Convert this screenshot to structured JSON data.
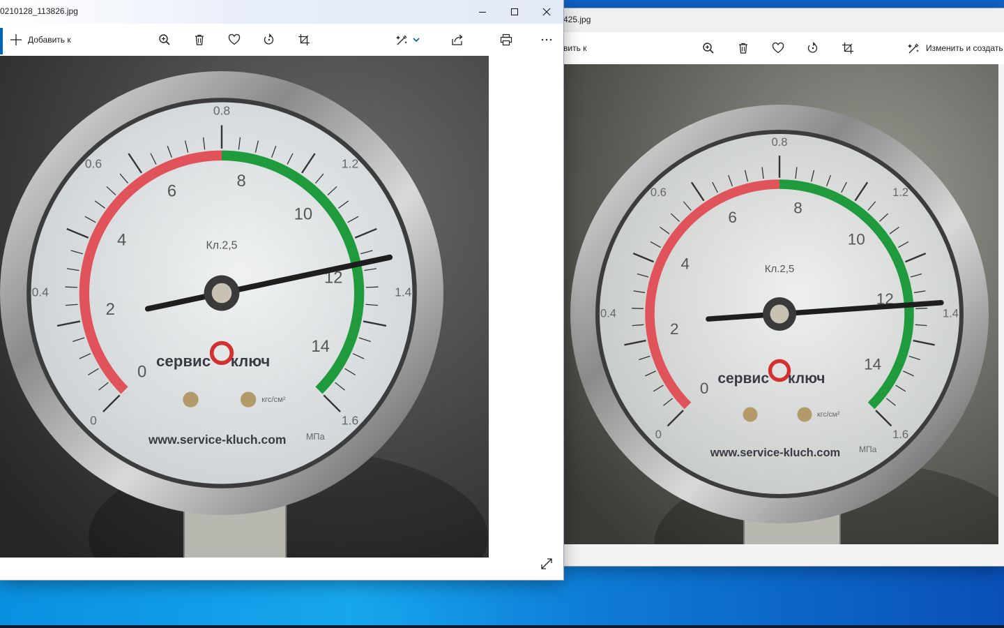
{
  "desktop": {
    "colors": {
      "top": "#0f63c8",
      "bottom": "#0a46a8",
      "glow": "#17a7ee"
    }
  },
  "window_back": {
    "title": "425.jpg",
    "toolbar": {
      "add_to_label": "вить к",
      "edit_create_label": "Изменить и создать"
    },
    "photo": {
      "gauge_class": "Кл.2,5",
      "brand_left": "сервис",
      "brand_right": "ключ",
      "website": "www.service-kluch.com",
      "unit_kgf": "кгс/см²",
      "unit_mpa": "МПа",
      "scale_kgf": [
        "0",
        "2",
        "4",
        "6",
        "8",
        "10",
        "12",
        "14"
      ],
      "scale_mpa": [
        "0",
        "0.4",
        "0.6",
        "0.8",
        "1.2",
        "1.4",
        "1.6"
      ]
    }
  },
  "window_front": {
    "title": "0210128_113826.jpg",
    "toolbar": {
      "add_to_label": "Добавить к"
    },
    "photo": {
      "gauge_class": "Кл.2,5",
      "brand_left": "сервис",
      "brand_right": "ключ",
      "website": "www.service-kluch.com",
      "unit_kgf": "кгс/см²",
      "unit_mpa": "МПа",
      "scale_kgf": [
        "0",
        "2",
        "4",
        "6",
        "8",
        "10",
        "12",
        "14"
      ],
      "scale_mpa": [
        "0",
        "0.4",
        "0.6",
        "0.8",
        "1.2",
        "1.4",
        "1.6"
      ]
    }
  },
  "icons": [
    "plus-icon",
    "zoom-icon",
    "delete-icon",
    "heart-icon",
    "rotate-icon",
    "crop-icon",
    "edit-icon",
    "share-icon",
    "print-icon",
    "more-icon",
    "minimize-icon",
    "maximize-icon",
    "close-icon",
    "fullscreen-icon"
  ]
}
